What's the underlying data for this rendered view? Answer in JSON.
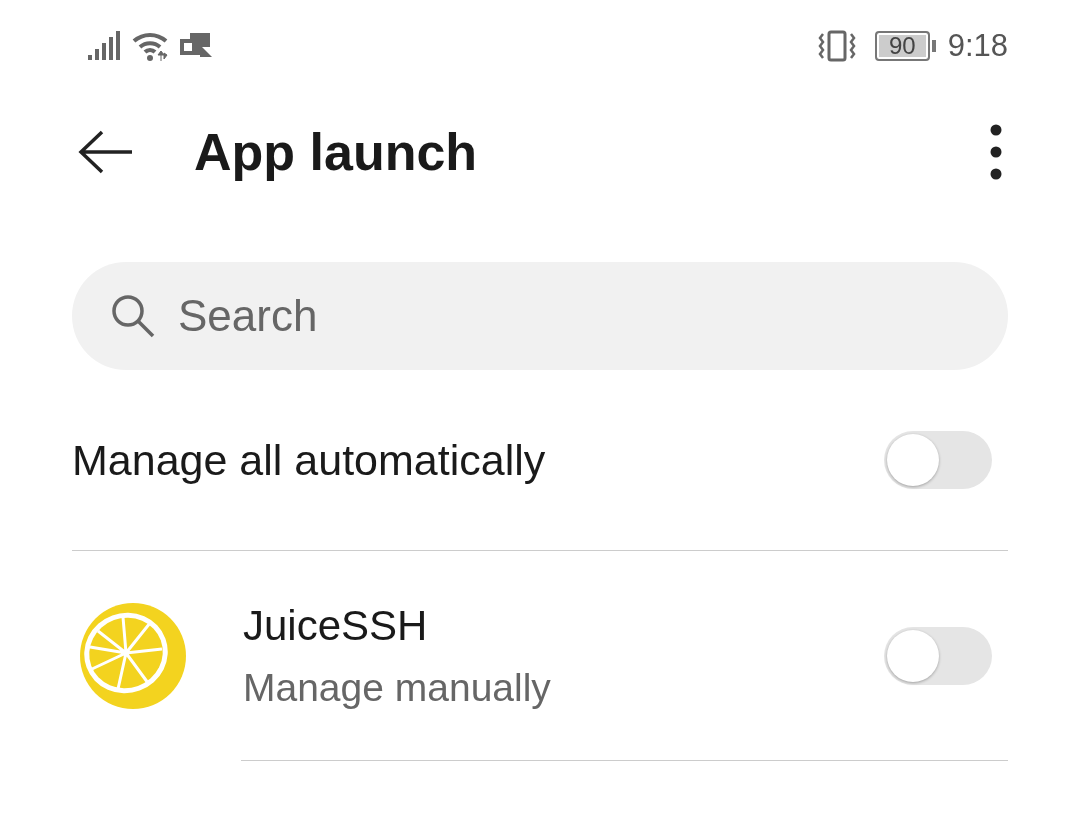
{
  "status_bar": {
    "battery": "90",
    "time": "9:18"
  },
  "header": {
    "title": "App launch"
  },
  "search": {
    "placeholder": "Search"
  },
  "settings": [
    {
      "kind": "toggle",
      "label": "Manage all automatically",
      "on": false
    },
    {
      "kind": "app",
      "name": "JuiceSSH",
      "subtitle": "Manage manually",
      "on": false
    }
  ]
}
